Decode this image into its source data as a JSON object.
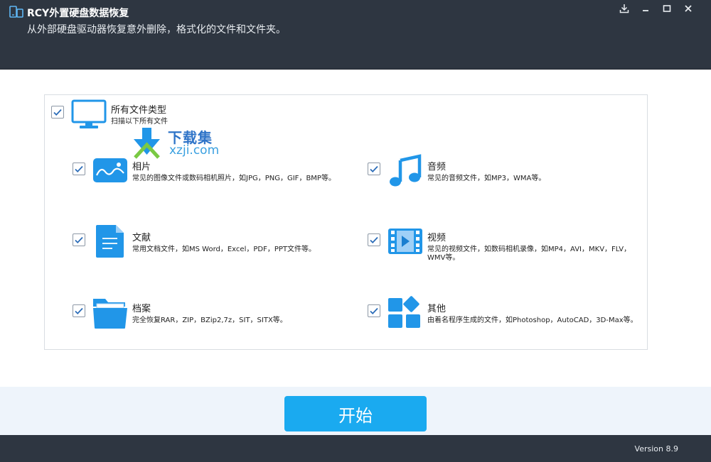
{
  "app": {
    "title": "RCY外置硬盘数据恢复",
    "subtitle": "从外部硬盘驱动器恢复意外删除，格式化的文件和文件夹。",
    "version": "Version 8.9"
  },
  "window_controls": [
    "download-icon",
    "minimize-icon",
    "maximize-icon",
    "close-icon"
  ],
  "all_types": {
    "title": "所有文件类型",
    "desc": "扫描以下所有文件",
    "checked": true,
    "icon": "monitor-icon"
  },
  "file_types": [
    {
      "id": "photos",
      "title": "相片",
      "desc": "常见的图像文件或数码相机照片，如JPG，PNG，GIF，BMP等。",
      "icon": "image-icon",
      "checked": true
    },
    {
      "id": "audio",
      "title": "音频",
      "desc": "常见的音频文件，如MP3，WMA等。",
      "icon": "music-note-icon",
      "checked": true
    },
    {
      "id": "documents",
      "title": "文献",
      "desc": "常用文档文件，如MS Word，Excel，PDF，PPT文件等。",
      "icon": "document-icon",
      "checked": true
    },
    {
      "id": "video",
      "title": "视频",
      "desc": "常见的视频文件，如数码相机录像，如MP4，AVI，MKV，FLV，WMV等。",
      "icon": "film-icon",
      "checked": true
    },
    {
      "id": "archives",
      "title": "档案",
      "desc": "完全恢复RAR，ZIP，BZip2,7z，SIT，SITX等。",
      "icon": "folder-icon",
      "checked": true
    },
    {
      "id": "other",
      "title": "其他",
      "desc": "由着名程序生成的文件，如Photoshop，AutoCAD，3D-Max等。",
      "icon": "apps-grid-icon",
      "checked": true
    }
  ],
  "start_button": {
    "label": "开始"
  },
  "watermark": {
    "cn": "下载集",
    "en": "xzji.com"
  },
  "colors": {
    "header_bg": "#2e3641",
    "accent": "#1aaaf0",
    "icon_blue": "#2196e8",
    "footer_band": "#eef4fb"
  }
}
